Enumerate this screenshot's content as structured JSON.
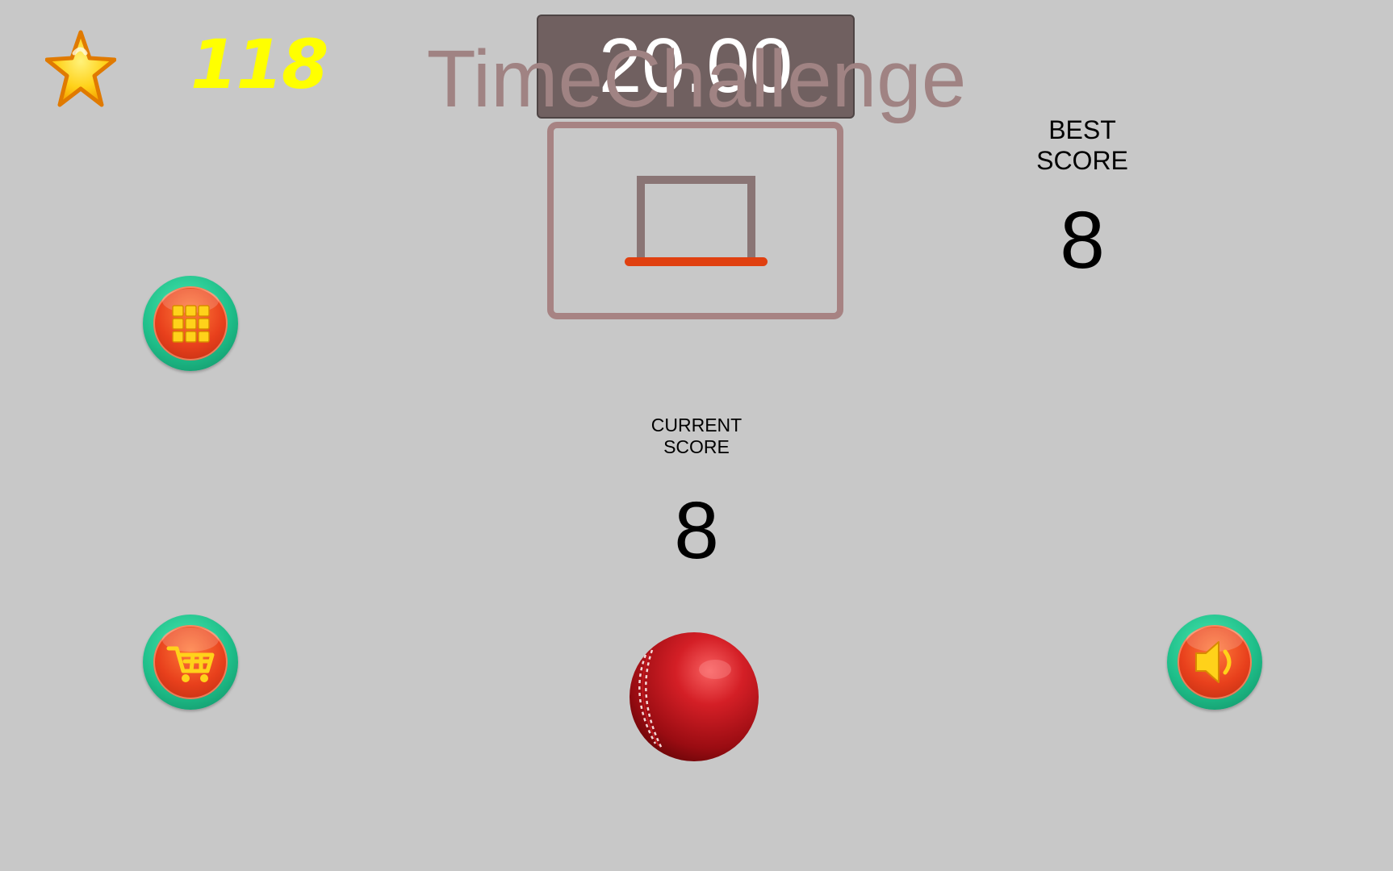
{
  "hud": {
    "coins": "118",
    "coin_icon": "star-icon",
    "timer": "20.00",
    "mode_title": "TimeChallenge"
  },
  "scores": {
    "best_label_line1": "BEST",
    "best_label_line2": "SCORE",
    "best_value": "8",
    "current_label_line1": "CURRENT",
    "current_label_line2": "SCORE",
    "current_value": "8"
  },
  "buttons": {
    "menu_icon": "grid-icon",
    "shop_icon": "cart-icon",
    "sound_icon": "speaker-icon"
  },
  "ball_icon": "cricket-ball-icon",
  "colors": {
    "background": "#c8c8c8",
    "coins": "#ffff00",
    "timer_bg": "#706060",
    "title": "#a08383",
    "backboard": "#a78383",
    "rim": "#e04010",
    "button_ring": "#1fbf8a",
    "button_face": "#e8401c"
  }
}
